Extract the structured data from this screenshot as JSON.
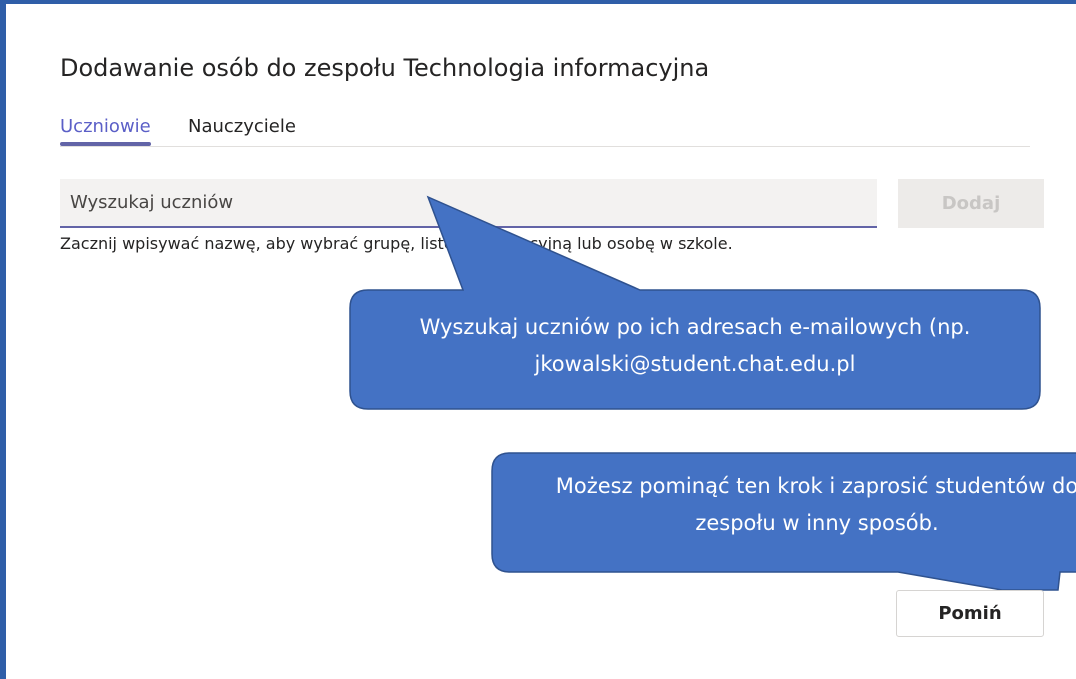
{
  "dialog": {
    "title": "Dodawanie osób do zespołu Technologia informacyjna",
    "tabs": [
      {
        "label": "Uczniowie"
      },
      {
        "label": "Nauczyciele"
      }
    ],
    "search": {
      "placeholder": "Wyszukaj uczniów"
    },
    "add_label": "Dodaj",
    "hint": "Zacznij wpisywać nazwę, aby wybrać grupę, listę dystrybucyjną lub osobę w szkole.",
    "skip_label": "Pomiń"
  },
  "callouts": [
    {
      "line1": "Wyszukaj uczniów po ich adresach e-mailowych (np.",
      "line2": "jkowalski@student.chat.edu.pl"
    },
    {
      "line1": "Możesz pominąć ten krok i zaprosić studentów do",
      "line2": "zespołu w inny sposób."
    }
  ],
  "colors": {
    "accent": "#6264a7",
    "callout_fill": "#4472c4",
    "callout_border": "#2f528f"
  }
}
